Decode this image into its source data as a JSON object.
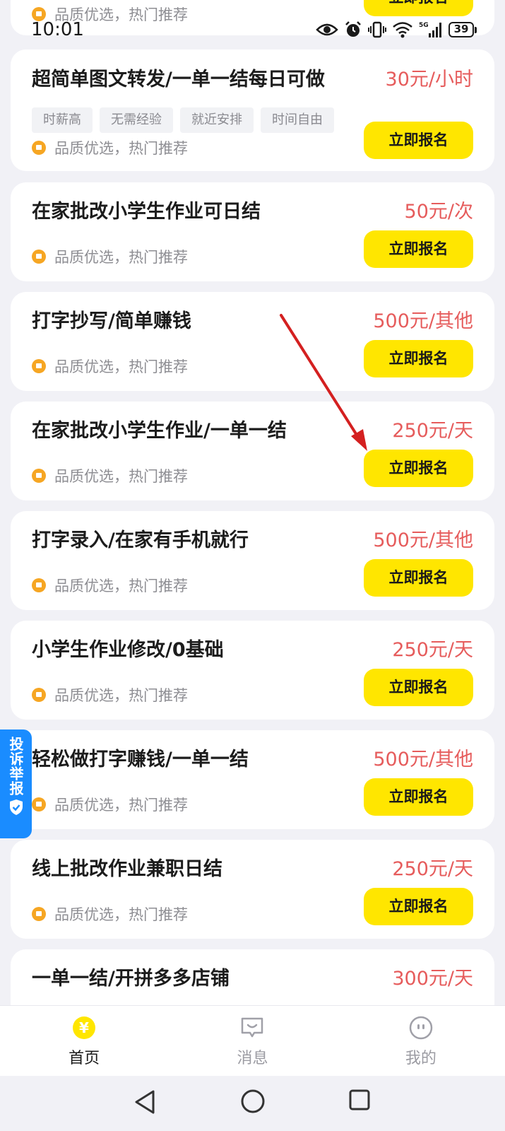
{
  "status_bar": {
    "time": "10:01",
    "battery": "39"
  },
  "partial_top": {
    "rec_text": "品质优选，热门推荐",
    "button": "立即报名"
  },
  "jobs": [
    {
      "title": "超简单图文转发/一单一结每日可做",
      "price": "30元/小时",
      "tags": [
        "时薪高",
        "无需经验",
        "就近安排",
        "时间自由"
      ],
      "rec_text": "品质优选，热门推荐",
      "button": "立即报名"
    },
    {
      "title": "在家批改小学生作业可日结",
      "price": "50元/次",
      "rec_text": "品质优选，热门推荐",
      "button": "立即报名"
    },
    {
      "title": "打字抄写/简单赚钱",
      "price": "500元/其他",
      "rec_text": "品质优选，热门推荐",
      "button": "立即报名"
    },
    {
      "title": "在家批改小学生作业/一单一结",
      "price": "250元/天",
      "rec_text": "品质优选，热门推荐",
      "button": "立即报名"
    },
    {
      "title": "打字录入/在家有手机就行",
      "price": "500元/其他",
      "rec_text": "品质优选，热门推荐",
      "button": "立即报名"
    },
    {
      "title": "小学生作业修改/0基础",
      "price": "250元/天",
      "rec_text": "品质优选，热门推荐",
      "button": "立即报名"
    },
    {
      "title": "轻松做打字赚钱/一单一结",
      "price": "500元/其他",
      "rec_text": "品质优选，热门推荐",
      "button": "立即报名"
    },
    {
      "title": "线上批改作业兼职日结",
      "price": "250元/天",
      "rec_text": "品质优选，热门推荐",
      "button": "立即报名"
    },
    {
      "title": "一单一结/开拼多多店铺",
      "price": "300元/天"
    }
  ],
  "report_tab": {
    "label": "投诉举报"
  },
  "bottom_nav": [
    {
      "label": "首页",
      "icon": "yuan-coin-icon",
      "active": true
    },
    {
      "label": "消息",
      "icon": "message-icon",
      "active": false
    },
    {
      "label": "我的",
      "icon": "profile-face-icon",
      "active": false
    }
  ],
  "colors": {
    "accent_yellow": "#ffe600",
    "price_red": "#e65c5c",
    "report_blue": "#1a8cff",
    "arrow_red": "#d42020"
  }
}
